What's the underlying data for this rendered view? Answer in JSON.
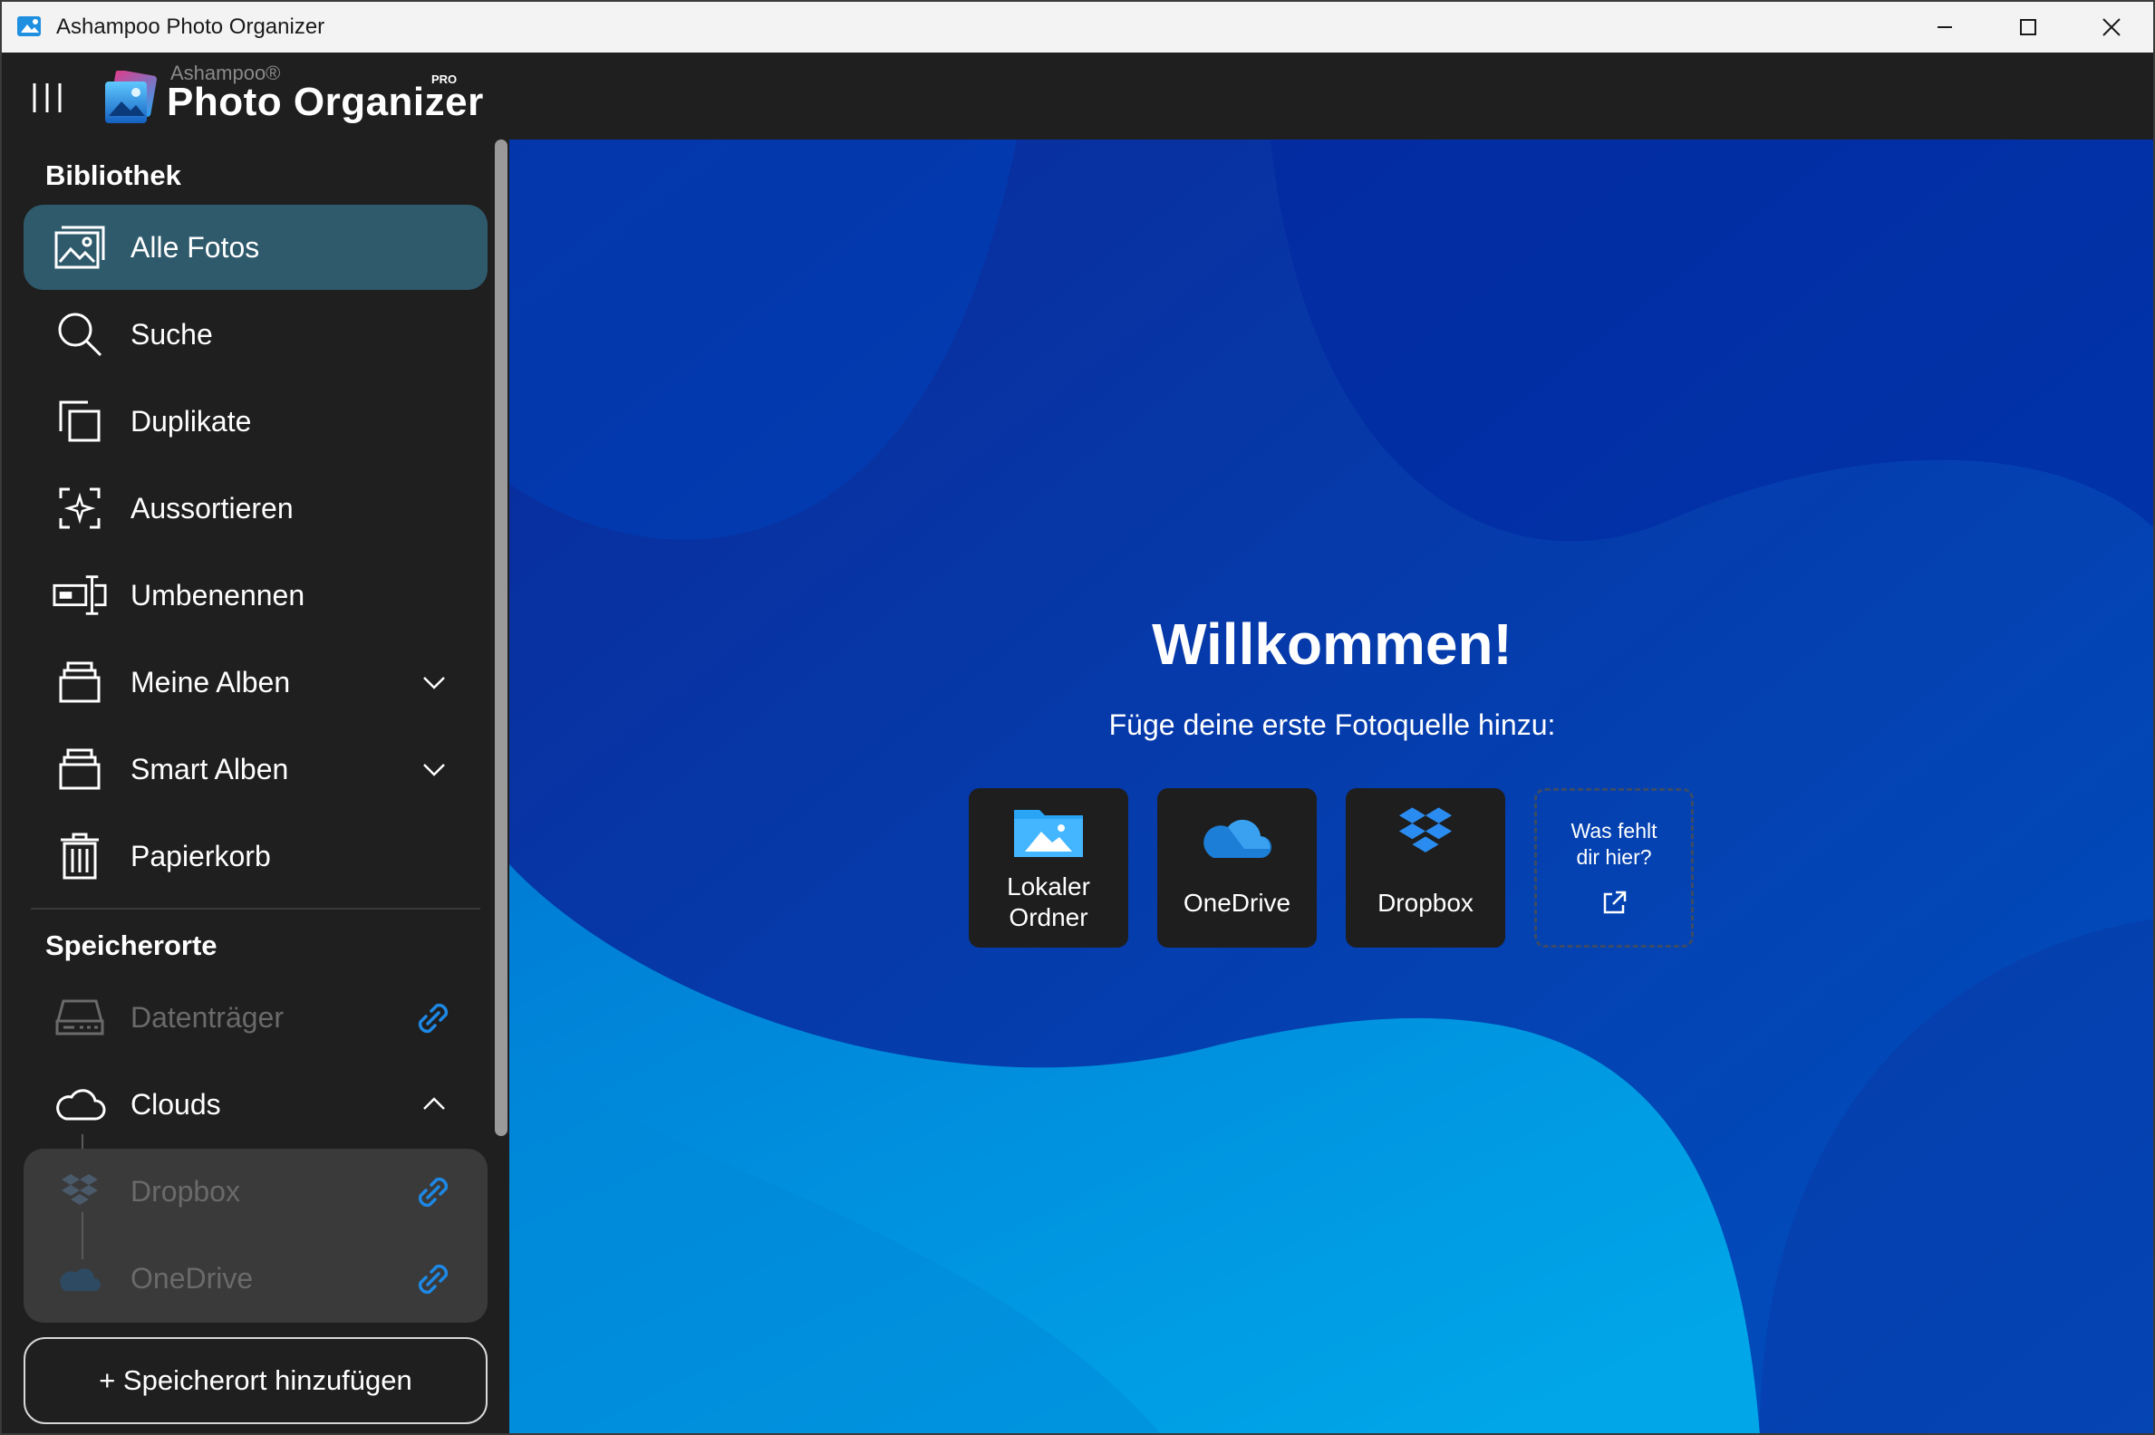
{
  "window": {
    "title": "Ashampoo Photo Organizer"
  },
  "header": {
    "brand_small": "Ashampoo®",
    "brand_big": "Photo Organizer",
    "brand_pro": "PRO"
  },
  "sidebar": {
    "library_title": "Bibliothek",
    "library_items": [
      {
        "label": "Alle Fotos",
        "icon": "image-gallery-icon",
        "active": true
      },
      {
        "label": "Suche",
        "icon": "search-icon"
      },
      {
        "label": "Duplikate",
        "icon": "duplicates-icon"
      },
      {
        "label": "Aussortieren",
        "icon": "sparkle-frame-icon"
      },
      {
        "label": "Umbenennen",
        "icon": "rename-icon"
      },
      {
        "label": "Meine Alben",
        "icon": "album-stack-icon",
        "expandable": true
      },
      {
        "label": "Smart Alben",
        "icon": "album-stack-icon",
        "expandable": true
      },
      {
        "label": "Papierkorb",
        "icon": "trash-icon"
      }
    ],
    "locations_title": "Speicherorte",
    "location_items": [
      {
        "label": "Datenträger",
        "icon": "drive-icon",
        "disabled": true
      },
      {
        "label": "Clouds",
        "icon": "cloud-icon",
        "expanded": true
      }
    ],
    "cloud_items": [
      {
        "label": "Dropbox",
        "icon": "dropbox-icon"
      },
      {
        "label": "OneDrive",
        "icon": "onedrive-icon"
      }
    ],
    "add_location_label": "+ Speicherort hinzufügen"
  },
  "main": {
    "welcome_title": "Willkommen!",
    "subtitle": "Füge deine erste Fotoquelle hinzu:",
    "tiles": [
      {
        "label_line1": "Lokaler",
        "label_line2": "Ordner",
        "icon": "folder-image-icon"
      },
      {
        "label": "OneDrive",
        "icon": "onedrive-icon"
      },
      {
        "label": "Dropbox",
        "icon": "dropbox-icon"
      },
      {
        "label_line1": "Was fehlt",
        "label_line2": "dir hier?",
        "icon": "external-link-icon"
      }
    ]
  },
  "colors": {
    "active_item_bg": "#2f5a6c",
    "link_blue": "#1e88e5",
    "main_bg_dark": "#0a2a8a",
    "main_bg_light": "#0096dc"
  }
}
